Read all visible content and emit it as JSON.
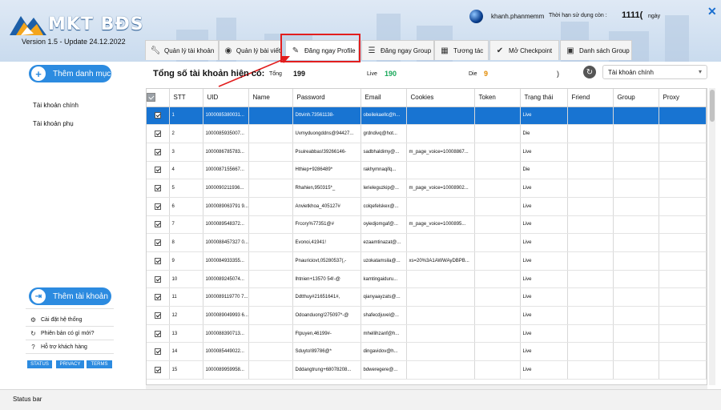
{
  "brand": {
    "name": "MKT BĐS",
    "version": "Version 1.5 - Update 24.12.2022"
  },
  "user": {
    "name": "khanh.phanmemm",
    "expiry_label": "Thời hạn sử dụng còn :",
    "expiry_value": "1111(",
    "expiry_unit": "ngày"
  },
  "tabs": [
    {
      "label": "Quản lý tài khoản",
      "icon": "wrench-icon"
    },
    {
      "label": "Quản lý bài viết",
      "icon": "eye-icon"
    },
    {
      "label": "Đăng ngay Profile",
      "icon": "pencil-icon"
    },
    {
      "label": "Đăng ngay Group",
      "icon": "list-icon"
    },
    {
      "label": "Tương tác",
      "icon": "grid-icon"
    },
    {
      "label": "Mở Checkpoint",
      "icon": "check-circle-icon"
    },
    {
      "label": "Danh sách Group",
      "icon": "folder-icon"
    }
  ],
  "sidebar": {
    "add_category": "Thêm danh mục",
    "items": [
      "Tài khoản chính",
      "Tài khoản phụ"
    ],
    "add_account": "Thêm tài khoản",
    "settings": [
      "Cài đặt hệ thống",
      "Phiên bản có gì mới?",
      "Hỗ trợ khách hàng"
    ],
    "chips": [
      "STATUS",
      "PRIVACY",
      "TERMS"
    ]
  },
  "summary": {
    "label": "Tổng số tài khoản hiện có:",
    "total_label": "Tổng",
    "total": "199",
    "live_label": "Live",
    "live": "190",
    "die_label": "Die",
    "die": "9",
    "paren": ")"
  },
  "account_filter": "Tài khoản chính",
  "colors": {
    "accent": "#2c8be0",
    "selected_row": "#1874d2",
    "live": "#19a85a",
    "die": "#e28a00",
    "highlight": "#e21e1e"
  },
  "table": {
    "columns": [
      "",
      "STT",
      "UID",
      "Name",
      "Password",
      "Email",
      "Cookies",
      "Token",
      "Trạng thái",
      "Friend",
      "Group",
      "Proxy"
    ],
    "rows": [
      [
        "1",
        "1000085380031...",
        "",
        "Dttvinh.73561138-",
        "obeilekaellc@h...",
        "",
        "",
        "Live",
        "",
        "",
        ""
      ],
      [
        "2",
        "1000085935007...",
        "",
        "Uvmyduongddns@94427...",
        "grdndivq@hot...",
        "",
        "",
        "Die",
        "",
        "",
        ""
      ],
      [
        "3",
        "1000086785783...",
        "",
        "Psuireabbas!39266146-",
        "sadbhaldimy@...",
        "m_page_voice=10008867...",
        "",
        "Live",
        "",
        "",
        ""
      ],
      [
        "4",
        "1000087155667...",
        "",
        "Hthiep+9286489*",
        "rakhymnaqifq...",
        "",
        "",
        "Die",
        "",
        "",
        ""
      ],
      [
        "5",
        "1000090211936...",
        "",
        "Rhahien,950315*_",
        "lerieleguzkip@...",
        "m_page_voice=10008902...",
        "",
        "Live",
        "",
        "",
        ""
      ],
      [
        "6",
        "1000089063791 9...",
        "",
        "Anvietkhoa_405127#",
        "colqefelskex@...",
        "",
        "",
        "Live",
        "",
        "",
        ""
      ],
      [
        "7",
        "1000089548372...",
        "",
        "Frcory%77351@#",
        "oyiedjomgaf@...",
        "m_page_voice=1000895...",
        "",
        "Live",
        "",
        "",
        ""
      ],
      [
        "8",
        "1000088457327 0...",
        "",
        "Evonoi,41941!",
        "ezaamtinazat@...",
        "",
        "",
        "Live",
        "",
        "",
        ""
      ],
      [
        "9",
        "1000084933355...",
        "",
        "Pnauriciovt,05280537(,-",
        "uzokatamsila@...",
        "xs=20%3A1AWWAyDBPB...",
        "",
        "Live",
        "",
        "",
        ""
      ],
      [
        "10",
        "1000089245074...",
        "",
        "Ihtnien+13570 54!-@",
        "kamtingaiduru...",
        "",
        "",
        "Live",
        "",
        "",
        ""
      ],
      [
        "11",
        "1000089119770 7...",
        "",
        "Ddtthuy#21651641#,",
        "qianyaayzats@...",
        "",
        "",
        "Live",
        "",
        "",
        ""
      ],
      [
        "12",
        "1000089049993 6...",
        "",
        "Odoanduong!275097*-@",
        "shafecdjuvel@...",
        "",
        "",
        "Live",
        "",
        "",
        ""
      ],
      [
        "13",
        "1000088390713...",
        "",
        "Ftpuyen,46199#-",
        "mhellihzanf@h...",
        "",
        "",
        "Live",
        "",
        "",
        ""
      ],
      [
        "14",
        "1000085449022...",
        "",
        "Sduyto!89786@*",
        "dingavidov@h...",
        "",
        "",
        "Live",
        "",
        "",
        ""
      ],
      [
        "15",
        "1000089959958...",
        "",
        "Dddangtrung+68078208...",
        "bdweregere@...",
        "",
        "",
        "Live",
        "",
        "",
        ""
      ]
    ]
  },
  "status_bar": "Status bar"
}
